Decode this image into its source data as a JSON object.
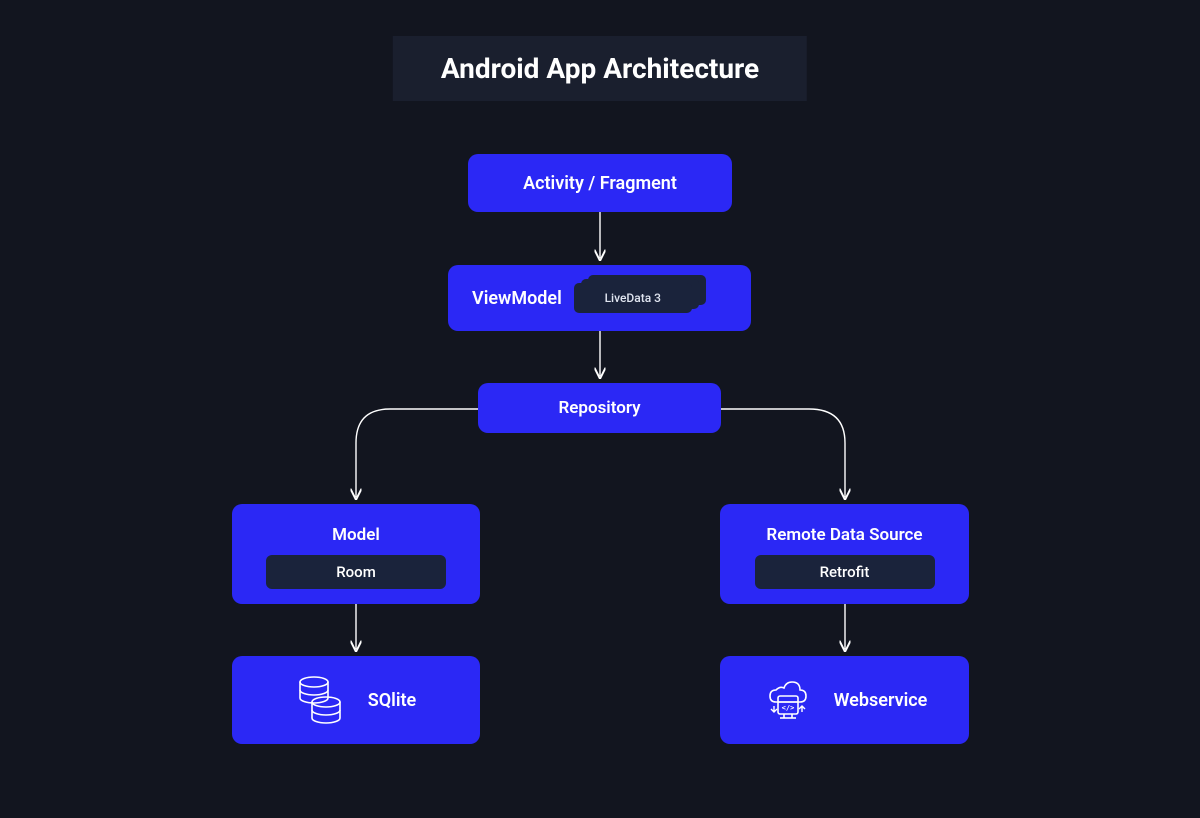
{
  "title": "Android App Architecture",
  "nodes": {
    "activity": "Activity / Fragment",
    "viewmodel": "ViewModel",
    "livedata": "LiveData 3",
    "repository": "Repository",
    "model": "Model",
    "room": "Room",
    "remote": "Remote Data Source",
    "retrofit": "Retrofit",
    "sqlite": "SQlite",
    "webservice": "Webservice"
  },
  "colors": {
    "bg": "#12151f",
    "titleBg": "#1a1f2e",
    "node": "#2b28f5",
    "chip": "#1a233b",
    "arrow": "#ffffff"
  }
}
